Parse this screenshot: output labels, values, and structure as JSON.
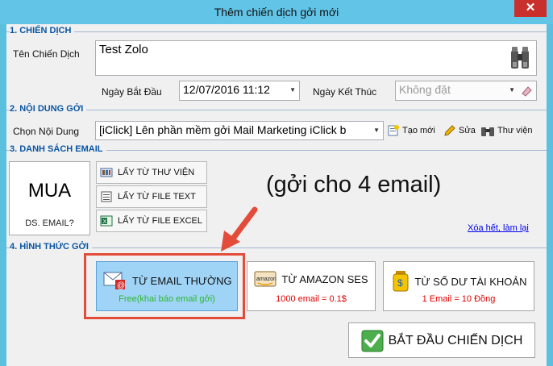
{
  "window": {
    "title": "Thêm chiến dịch gởi mới",
    "close_label": "✕"
  },
  "section1": {
    "label": "1. CHIẾN DỊCH",
    "campaign_name_label": "Tên Chiến Dịch",
    "campaign_name_value": "Test Zolo",
    "start_date_label": "Ngày Bắt Đầu",
    "start_date_value": "12/07/2016  11:12",
    "end_date_label": "Ngày Kết Thúc",
    "end_date_value": "Không đặt"
  },
  "section2": {
    "label": "2. NỘI DUNG GỞI",
    "content_label": "Chọn Nội Dung",
    "content_value": "[iClick] Lên phần mềm gởi Mail Marketing iClick b",
    "new_label": "Tạo mới",
    "edit_label": "Sửa",
    "library_label": "Thư viện"
  },
  "section3": {
    "label": "3. DANH SÁCH EMAIL",
    "buy_title": "MUA",
    "buy_subtitle": "DS. EMAIL?",
    "from_library": "LẤY TỪ THƯ VIỆN",
    "from_text": "LẤY TỪ FILE TEXT",
    "from_excel": "LẤY TỪ FILE EXCEL",
    "email_count_note": "(gởi cho 4 email)",
    "clear_link": "Xóa hết, làm lại"
  },
  "section4": {
    "label": "4. HÌNH THỨC GỞI",
    "options": [
      {
        "title": "TỪ EMAIL THƯỜNG",
        "sub": "Free(khai báo email gởi)",
        "sub_color": "#2eb82e",
        "selected": true
      },
      {
        "title": "TỪ AMAZON SES",
        "sub": "1000 email = 0.1$",
        "sub_color": "#e00000",
        "selected": false
      },
      {
        "title": "TỪ SỐ DƯ TÀI KHOẢN",
        "sub": "1 Email = 10 Đồng",
        "sub_color": "#e00000",
        "selected": false
      }
    ],
    "start_label": "BẮT ĐẦU CHIẾN DỊCH"
  },
  "colors": {
    "section_label": "#0a55a3",
    "title_bar": "#62c4e6",
    "close": "#c9302c",
    "selected_bg": "#9fd4f7",
    "annotation": "#e34c3a"
  },
  "icons": [
    "binoculars-icon",
    "calendar-clear-icon",
    "new-document-icon",
    "pencil-icon",
    "library-binoculars-icon",
    "library-icon",
    "text-file-icon",
    "excel-icon",
    "email-icon",
    "amazon-icon",
    "money-jar-icon",
    "checkmark-icon",
    "arrow-annotation-icon"
  ]
}
